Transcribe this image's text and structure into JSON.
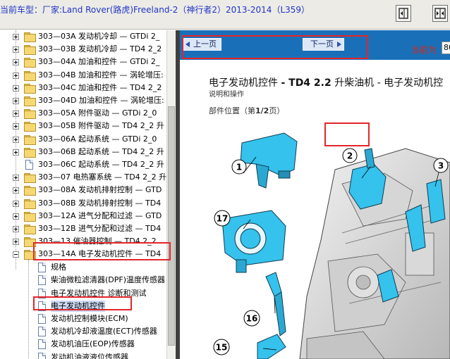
{
  "header": {
    "vehicle_label": "当前车型：",
    "vehicle_value": "厂家:Land Rover(路虎)Freeland-2（神行者2）2013-2014（L359）",
    "buttons": [
      {
        "icon": "collapse-panel-icon"
      },
      {
        "icon": "expand-panel-icon"
      }
    ]
  },
  "tree": {
    "items": [
      {
        "code": "303—03A",
        "text": "发动机冷却 — GTDi 2_",
        "type": "folder",
        "state": "collapsed"
      },
      {
        "code": "303—03B",
        "text": "发动机冷却 — TD4 2_2",
        "type": "folder",
        "state": "collapsed"
      },
      {
        "code": "303—04A",
        "text": "加油和控件 — GTDi 2_",
        "type": "folder",
        "state": "collapsed"
      },
      {
        "code": "303—04B",
        "text": "加油和控件 — 涡轮增压:",
        "type": "folder",
        "state": "collapsed"
      },
      {
        "code": "303—04C",
        "text": "加油和控件 — TD4 2_2",
        "type": "folder",
        "state": "collapsed"
      },
      {
        "code": "303—04D",
        "text": "加油和控件 — 涡轮增压:",
        "type": "folder",
        "state": "collapsed"
      },
      {
        "code": "303—05A",
        "text": "附件驱动 — GTDi 2_0",
        "type": "folder",
        "state": "collapsed"
      },
      {
        "code": "303—05B",
        "text": "附件驱动 — TD4 2_2 升",
        "type": "folder",
        "state": "collapsed"
      },
      {
        "code": "303—06A",
        "text": "起动系统 — GTDi 2_0",
        "type": "folder",
        "state": "collapsed"
      },
      {
        "code": "303—06B",
        "text": "起动系统 — TD4 2_2 升",
        "type": "folder",
        "state": "collapsed"
      },
      {
        "code": "303—06C",
        "text": "起动系统 — TD4 2_2 升",
        "type": "doc",
        "state": "none"
      },
      {
        "code": "303—07",
        "text": "电热塞系统 — TD4 2_2 升",
        "type": "folder",
        "state": "collapsed"
      },
      {
        "code": "303—08A",
        "text": "发动机排射控制 — GTD",
        "type": "folder",
        "state": "collapsed"
      },
      {
        "code": "303—08B",
        "text": "发动机排射控制 — TD4",
        "type": "folder",
        "state": "collapsed"
      },
      {
        "code": "303—12A",
        "text": "进气分配和过滤 — GTD",
        "type": "folder",
        "state": "collapsed"
      },
      {
        "code": "303—12B",
        "text": "进气分配和过滤 — TD4",
        "type": "folder",
        "state": "collapsed"
      },
      {
        "code": "303—13",
        "text": "催油器控制 — TD4 2_2",
        "type": "folder",
        "state": "collapsed"
      },
      {
        "code": "303—14A",
        "text": "电子发动机控件 — TD4",
        "type": "folder",
        "state": "expanded"
      }
    ],
    "children": [
      {
        "text": "规格"
      },
      {
        "text": "柴油微粒滤清器(DPF)温度传感器"
      },
      {
        "text": "电子发动机控件 诊断和测试"
      },
      {
        "text": "电子发动机控件",
        "selected": true
      },
      {
        "text": "发动机控制模块(ECM)"
      },
      {
        "text": "发动机冷却液温度(ECT)传感器"
      },
      {
        "text": "发动机油压(EOP)传感器"
      },
      {
        "text": "发动机油液液位传感器"
      }
    ]
  },
  "nav": {
    "prev_label": "上一页",
    "next_label": "下一页",
    "current_label": "当前为",
    "page_value": "80"
  },
  "document": {
    "title_prefix": "电子发动机控件",
    "title_bold": "- TD4 2.2",
    "title_suffix": "升柴油机 - 电子发动机控",
    "subtitle": "说明和操作",
    "parts_heading": "部件位置（第",
    "parts_page": "1/2",
    "parts_heading_end": "页）",
    "callouts": [
      "1",
      "2",
      "3",
      "17",
      "16",
      "15"
    ]
  },
  "colors": {
    "highlight": "#e3262b",
    "nav_blue": "#1a70b8",
    "vehicle_text": "#2034c4",
    "current_page_text": "#d2281a",
    "part_cyan": "#35c2ec"
  }
}
